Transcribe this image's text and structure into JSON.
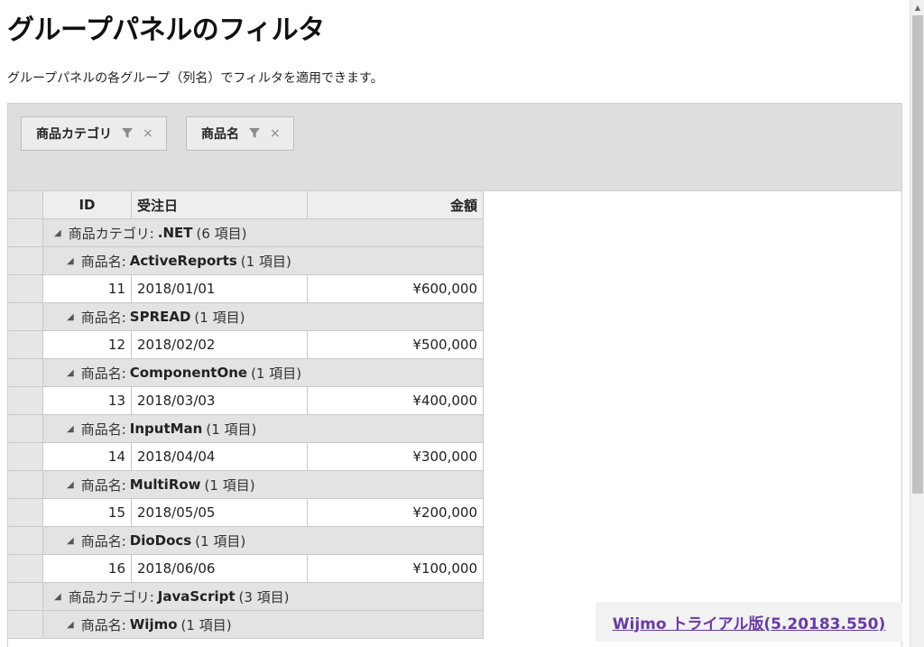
{
  "page": {
    "title": "グループパネルのフィルタ",
    "description": "グループパネルの各グループ（列名）でフィルタを適用できます。"
  },
  "group_panel": {
    "chips": [
      {
        "label": "商品カテゴリ",
        "filter_icon": "filter-icon",
        "close": "×"
      },
      {
        "label": "商品名",
        "filter_icon": "filter-icon",
        "close": "×"
      }
    ]
  },
  "grid": {
    "columns": [
      "ID",
      "受注日",
      "金額"
    ],
    "rows": [
      {
        "type": "group",
        "level": 0,
        "prefix": "商品カテゴリ:",
        "value": ".NET",
        "count": "(6 項目)"
      },
      {
        "type": "group",
        "level": 1,
        "prefix": "商品名:",
        "value": "ActiveReports",
        "count": "(1 項目)"
      },
      {
        "type": "data",
        "id": "11",
        "date": "2018/01/01",
        "amount": "¥600,000"
      },
      {
        "type": "group",
        "level": 1,
        "prefix": "商品名:",
        "value": "SPREAD",
        "count": "(1 項目)"
      },
      {
        "type": "data",
        "id": "12",
        "date": "2018/02/02",
        "amount": "¥500,000"
      },
      {
        "type": "group",
        "level": 1,
        "prefix": "商品名:",
        "value": "ComponentOne",
        "count": "(1 項目)"
      },
      {
        "type": "data",
        "id": "13",
        "date": "2018/03/03",
        "amount": "¥400,000"
      },
      {
        "type": "group",
        "level": 1,
        "prefix": "商品名:",
        "value": "InputMan",
        "count": "(1 項目)"
      },
      {
        "type": "data",
        "id": "14",
        "date": "2018/04/04",
        "amount": "¥300,000"
      },
      {
        "type": "group",
        "level": 1,
        "prefix": "商品名:",
        "value": "MultiRow",
        "count": "(1 項目)"
      },
      {
        "type": "data",
        "id": "15",
        "date": "2018/05/05",
        "amount": "¥200,000"
      },
      {
        "type": "group",
        "level": 1,
        "prefix": "商品名:",
        "value": "DioDocs",
        "count": "(1 項目)"
      },
      {
        "type": "data",
        "id": "16",
        "date": "2018/06/06",
        "amount": "¥100,000"
      },
      {
        "type": "group",
        "level": 0,
        "prefix": "商品カテゴリ:",
        "value": "JavaScript",
        "count": "(3 項目)"
      },
      {
        "type": "group",
        "level": 1,
        "prefix": "商品名:",
        "value": "Wijmo",
        "count": "(1 項目)"
      }
    ]
  },
  "banner": {
    "label": "Wijmo トライアル版(5.20183.550)"
  },
  "colors": {
    "banner_link": "#6a3ba3",
    "panel_bg": "#dedede",
    "group_row_bg": "#e3e3e3"
  }
}
